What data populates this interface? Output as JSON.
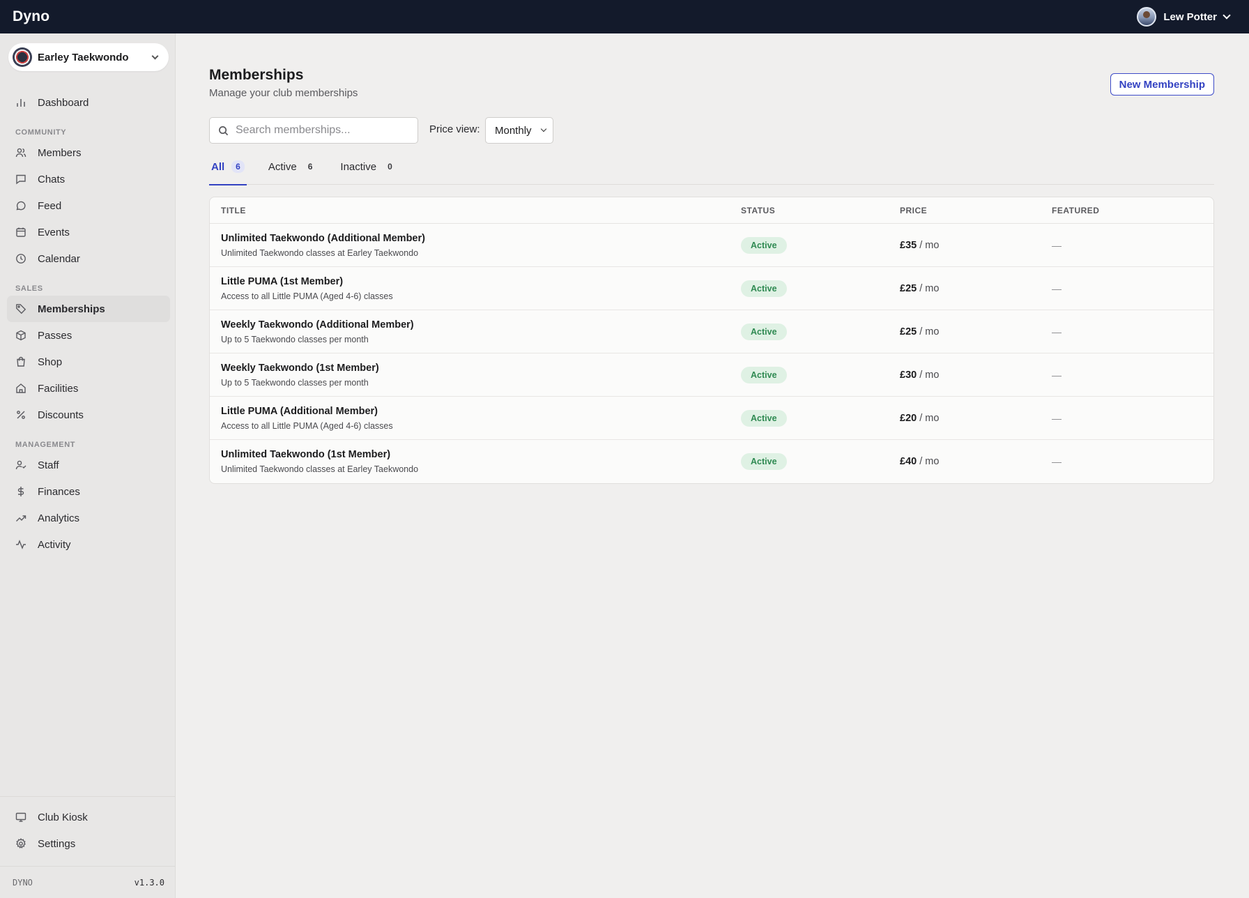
{
  "app": {
    "brand": "Dyno"
  },
  "user": {
    "name": "Lew Potter"
  },
  "club": {
    "name": "Earley Taekwondo"
  },
  "sidebar": {
    "dashboard": {
      "label": "Dashboard",
      "icon": "bar-chart-icon"
    },
    "sections": [
      {
        "title": "COMMUNITY",
        "items": [
          {
            "label": "Members",
            "icon": "users-icon"
          },
          {
            "label": "Chats",
            "icon": "chat-icon"
          },
          {
            "label": "Feed",
            "icon": "message-circle-icon"
          },
          {
            "label": "Events",
            "icon": "calendar-icon"
          },
          {
            "label": "Calendar",
            "icon": "clock-icon"
          }
        ]
      },
      {
        "title": "SALES",
        "items": [
          {
            "label": "Memberships",
            "icon": "tag-icon",
            "active": true
          },
          {
            "label": "Passes",
            "icon": "package-icon"
          },
          {
            "label": "Shop",
            "icon": "shopping-bag-icon"
          },
          {
            "label": "Facilities",
            "icon": "home-icon"
          },
          {
            "label": "Discounts",
            "icon": "percent-icon"
          }
        ]
      },
      {
        "title": "MANAGEMENT",
        "items": [
          {
            "label": "Staff",
            "icon": "user-check-icon"
          },
          {
            "label": "Finances",
            "icon": "dollar-icon"
          },
          {
            "label": "Analytics",
            "icon": "trending-up-icon"
          },
          {
            "label": "Activity",
            "icon": "activity-icon"
          }
        ]
      }
    ],
    "bottom": [
      {
        "label": "Club Kiosk",
        "icon": "monitor-icon"
      },
      {
        "label": "Settings",
        "icon": "gear-icon"
      }
    ],
    "footer": {
      "name": "DYNO",
      "version": "v1.3.0"
    }
  },
  "page": {
    "title": "Memberships",
    "subtitle": "Manage your club memberships",
    "new_button": "New Membership",
    "search": {
      "placeholder": "Search memberships...",
      "value": ""
    },
    "price_view": {
      "label": "Price view:",
      "value": "Monthly"
    },
    "tabs": [
      {
        "label": "All",
        "count": "6",
        "active": true
      },
      {
        "label": "Active",
        "count": "6"
      },
      {
        "label": "Inactive",
        "count": "0"
      }
    ]
  },
  "table": {
    "headers": {
      "title": "TITLE",
      "status": "STATUS",
      "price": "PRICE",
      "featured": "FEATURED"
    },
    "rows": [
      {
        "title": "Unlimited Taekwondo (Additional Member)",
        "desc": "Unlimited Taekwondo classes at Earley Taekwondo",
        "status": "Active",
        "price": "£35",
        "period": " / mo",
        "featured": "—"
      },
      {
        "title": "Little PUMA (1st Member)",
        "desc": "Access to all Little PUMA (Aged 4-6) classes",
        "status": "Active",
        "price": "£25",
        "period": " / mo",
        "featured": "—"
      },
      {
        "title": "Weekly Taekwondo (Additional Member)",
        "desc": "Up to 5 Taekwondo classes per month",
        "status": "Active",
        "price": "£25",
        "period": " / mo",
        "featured": "—"
      },
      {
        "title": "Weekly Taekwondo (1st Member)",
        "desc": "Up to 5 Taekwondo classes per month",
        "status": "Active",
        "price": "£30",
        "period": " / mo",
        "featured": "—"
      },
      {
        "title": "Little PUMA (Additional Member)",
        "desc": "Access to all Little PUMA (Aged 4-6) classes",
        "status": "Active",
        "price": "£20",
        "period": " / mo",
        "featured": "—"
      },
      {
        "title": "Unlimited Taekwondo (1st Member)",
        "desc": "Unlimited Taekwondo classes at Earley Taekwondo",
        "status": "Active",
        "price": "£40",
        "period": " / mo",
        "featured": "—"
      }
    ]
  },
  "colors": {
    "topbar": "#131a2b",
    "accent": "#3342c2",
    "active_badge_bg": "#dff1e4",
    "active_badge_text": "#2f8a52"
  }
}
